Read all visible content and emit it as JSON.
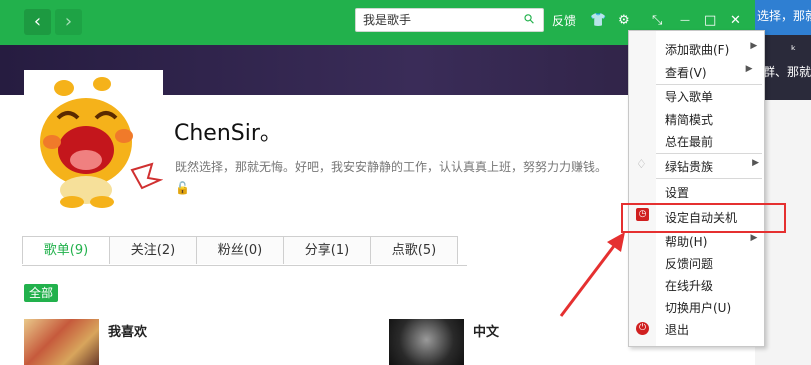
{
  "toolbar": {
    "back_icon": "‹",
    "forward_icon": "›",
    "search_placeholder": "我是歌手",
    "search_icon": "⚲",
    "feedback": "反馈",
    "shirt_icon": "👕",
    "gear_icon": "⚙",
    "mini_icon": "⤡",
    "minimize_icon": "—",
    "maximize_icon": "□",
    "close_icon": "✕"
  },
  "profile": {
    "username": "ChenSir。",
    "signature": "既然选择，那就无悔。好吧，我安安静静的工作，认认真真上班，努努力力赚钱。",
    "lock_icon": "🔓"
  },
  "tabs": [
    "歌单(9)",
    "关注(2)",
    "粉丝(0)",
    "分享(1)",
    "点歌(5)"
  ],
  "filter": {
    "all": "全部"
  },
  "playlists": [
    {
      "title": "我喜欢"
    },
    {
      "title": "中文"
    }
  ],
  "background_right": {
    "top_text": "选择，那就",
    "dark_text_1": "ᵏ",
    "dark_text_2": "群、那就"
  },
  "context_menu": {
    "items": [
      {
        "label": "添加歌曲(F)",
        "submenu": true
      },
      {
        "label": "查看(V)",
        "submenu": true
      },
      {
        "label": "导入歌单",
        "submenu": false
      },
      {
        "label": "精简模式",
        "submenu": false
      },
      {
        "label": "总在最前",
        "submenu": false
      },
      {
        "label": "绿钻贵族",
        "submenu": true
      },
      {
        "label": "设置",
        "submenu": false
      },
      {
        "label": "设定自动关机",
        "submenu": false
      },
      {
        "label": "帮助(H)",
        "submenu": true
      },
      {
        "label": "反馈问题",
        "submenu": false
      },
      {
        "label": "在线升级",
        "submenu": false
      },
      {
        "label": "切换用户(U)",
        "submenu": false
      },
      {
        "label": "退出",
        "submenu": false
      }
    ],
    "arrow": "▶"
  },
  "colors": {
    "brand_green": "#22b14c",
    "highlight_red": "#e53030"
  }
}
